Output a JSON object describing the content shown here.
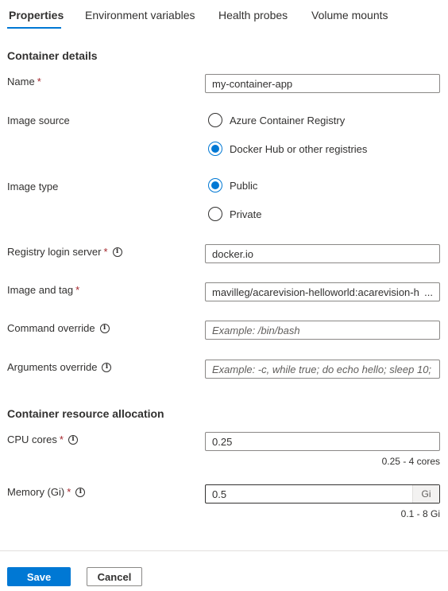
{
  "tabs": [
    {
      "label": "Properties",
      "active": true
    },
    {
      "label": "Environment variables",
      "active": false
    },
    {
      "label": "Health probes",
      "active": false
    },
    {
      "label": "Volume mounts",
      "active": false
    }
  ],
  "container_details": {
    "section_title": "Container details",
    "name": {
      "label": "Name",
      "required_mark": "*",
      "value": "my-container-app"
    },
    "image_source": {
      "label": "Image source",
      "options": [
        {
          "label": "Azure Container Registry",
          "selected": false
        },
        {
          "label": "Docker Hub or other registries",
          "selected": true
        }
      ]
    },
    "image_type": {
      "label": "Image type",
      "options": [
        {
          "label": "Public",
          "selected": true
        },
        {
          "label": "Private",
          "selected": false
        }
      ]
    },
    "registry_login_server": {
      "label": "Registry login server",
      "required_mark": "*",
      "value": "docker.io"
    },
    "image_and_tag": {
      "label": "Image and tag",
      "required_mark": "*",
      "value": "mavilleg/acarevision-helloworld:acarevision-h",
      "ellipsis": "..."
    },
    "command_override": {
      "label": "Command override",
      "placeholder": "Example: /bin/bash"
    },
    "arguments_override": {
      "label": "Arguments override",
      "placeholder": "Example: -c, while true; do echo hello; sleep 10; ..."
    }
  },
  "resource_allocation": {
    "section_title": "Container resource allocation",
    "cpu": {
      "label": "CPU cores",
      "required_mark": "*",
      "value": "0.25",
      "hint": "0.25 - 4 cores"
    },
    "memory": {
      "label": "Memory (Gi)",
      "required_mark": "*",
      "value": "0.5",
      "unit": "Gi",
      "hint": "0.1 - 8 Gi"
    }
  },
  "info_glyph": "i",
  "footer": {
    "save_label": "Save",
    "cancel_label": "Cancel"
  },
  "colors": {
    "accent": "#0078d4",
    "required": "#a4262c"
  }
}
